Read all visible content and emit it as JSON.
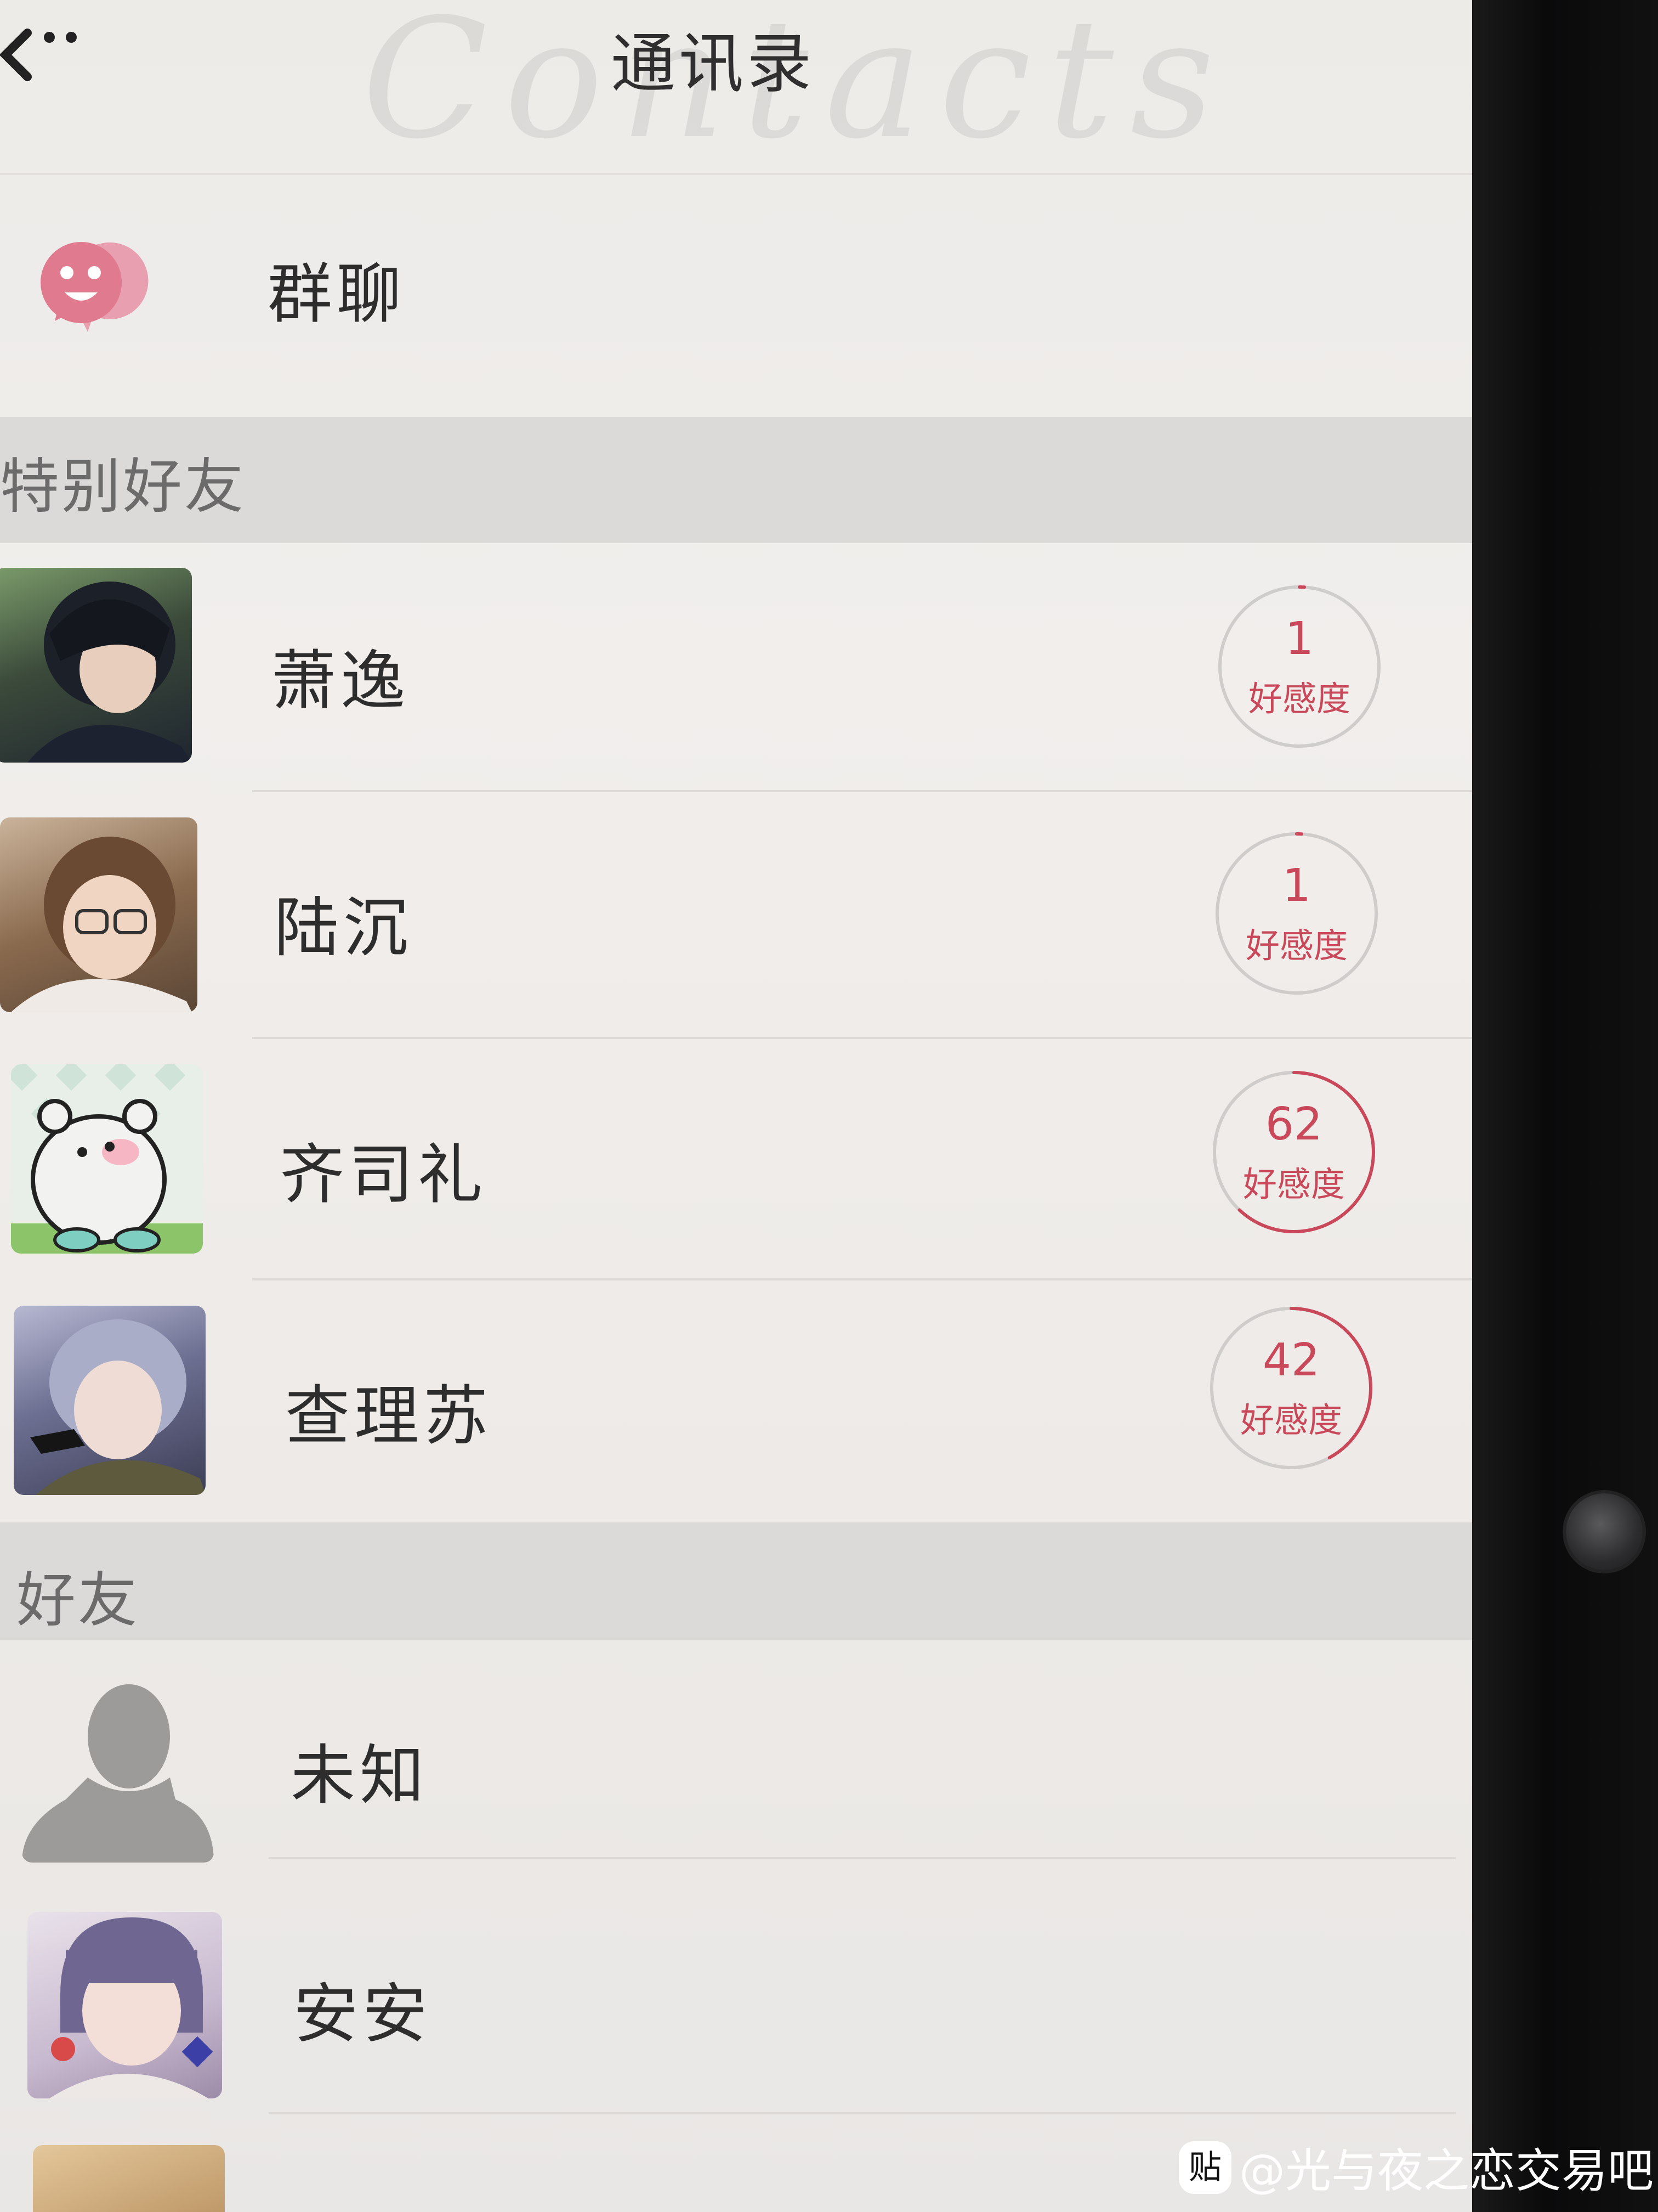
{
  "header": {
    "title": "通讯录",
    "deco_text": "Contacts"
  },
  "group_chat": {
    "label": "群聊"
  },
  "sections": {
    "special": "特别好友",
    "friends": "好友"
  },
  "special_friends": [
    {
      "name": "萧逸",
      "affection": "1",
      "affection_label": "好感度",
      "progress": 0.01
    },
    {
      "name": "陆沉",
      "affection": "1",
      "affection_label": "好感度",
      "progress": 0.01
    },
    {
      "name": "齐司礼",
      "affection": "62",
      "affection_label": "好感度",
      "progress": 0.62
    },
    {
      "name": "查理苏",
      "affection": "42",
      "affection_label": "好感度",
      "progress": 0.42
    }
  ],
  "friends": [
    {
      "name": "未知"
    },
    {
      "name": "安安"
    }
  ],
  "watermark": {
    "icon": "贴",
    "text": "@光与夜之恋交易吧"
  },
  "colors": {
    "accent": "#c9485a",
    "ring": "#cfcdcb",
    "group_icon": "#e07a8f"
  }
}
